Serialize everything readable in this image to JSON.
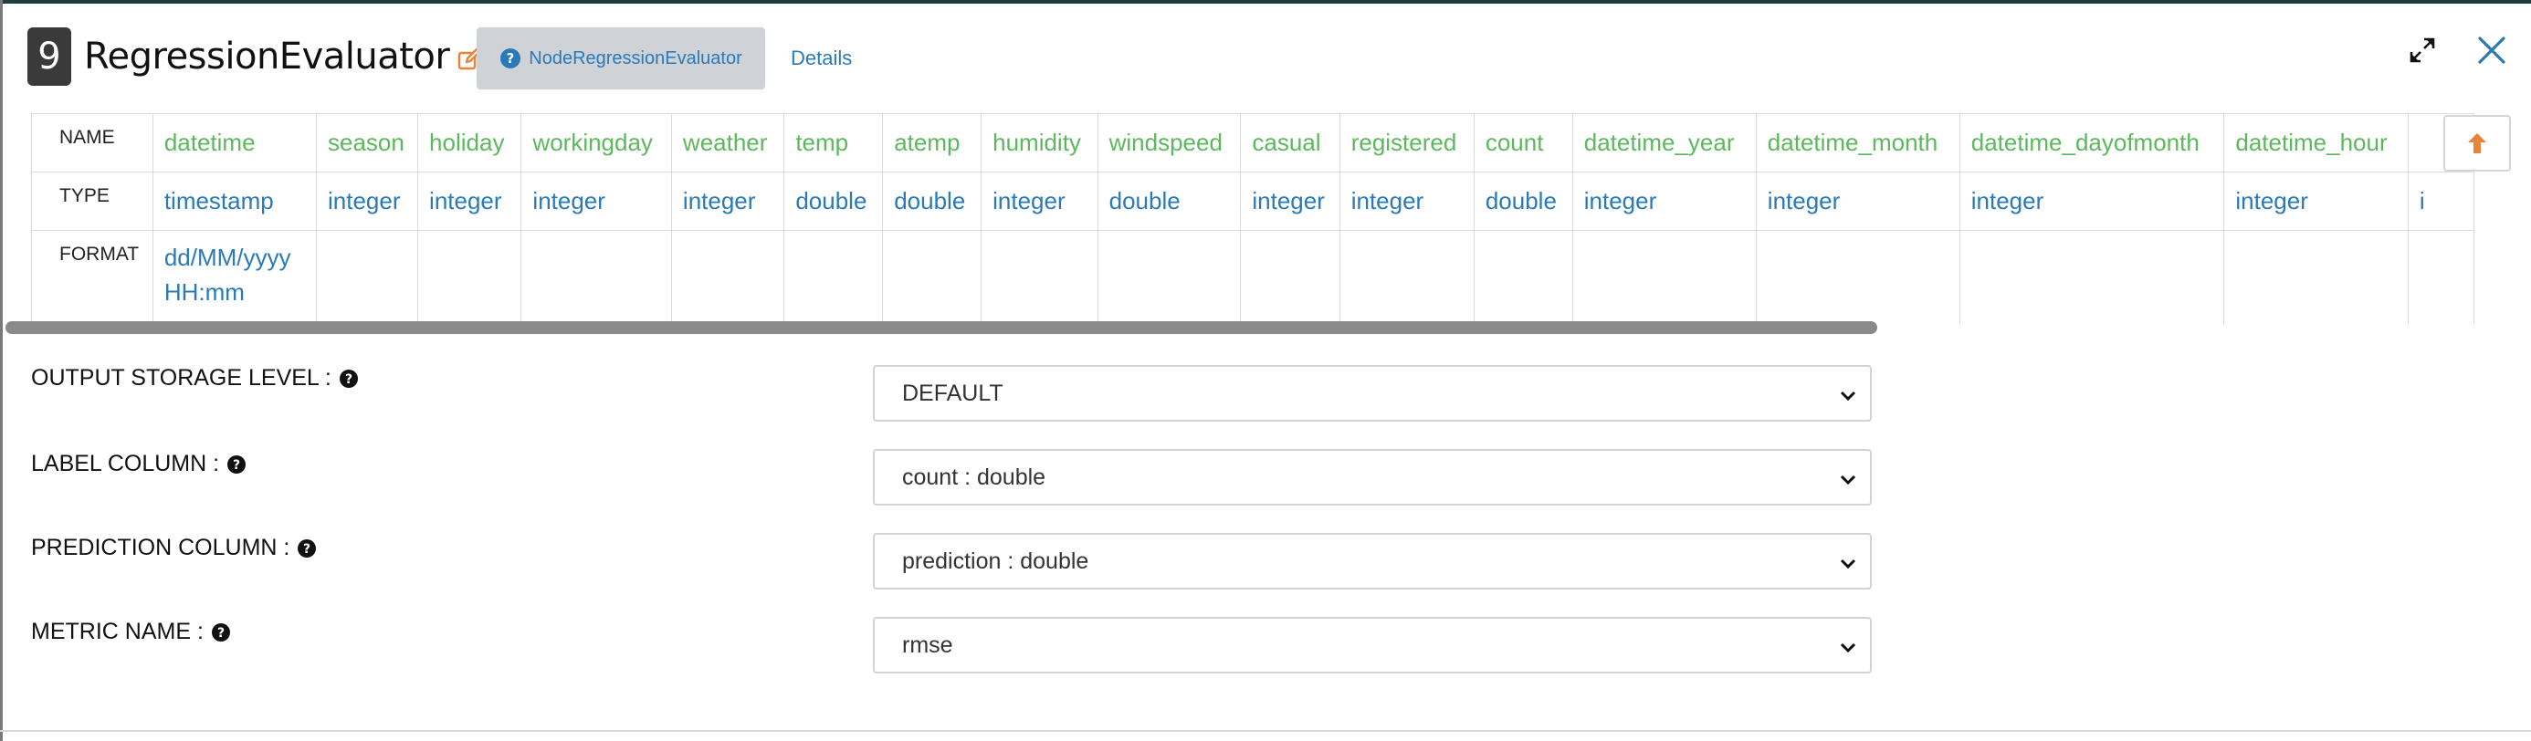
{
  "header": {
    "node_number": "9",
    "title": "RegressionEvaluator",
    "tabs": [
      {
        "label": "NodeRegressionEvaluator",
        "icon": "question-circle-icon"
      },
      {
        "label": "Details"
      }
    ]
  },
  "schema": {
    "row_labels": [
      "NAME",
      "TYPE",
      "FORMAT"
    ],
    "columns": [
      {
        "name": "datetime",
        "type": "timestamp",
        "format": "dd/MM/yyyy HH:mm"
      },
      {
        "name": "season",
        "type": "integer",
        "format": ""
      },
      {
        "name": "holiday",
        "type": "integer",
        "format": ""
      },
      {
        "name": "workingday",
        "type": "integer",
        "format": ""
      },
      {
        "name": "weather",
        "type": "integer",
        "format": ""
      },
      {
        "name": "temp",
        "type": "double",
        "format": ""
      },
      {
        "name": "atemp",
        "type": "double",
        "format": ""
      },
      {
        "name": "humidity",
        "type": "integer",
        "format": ""
      },
      {
        "name": "windspeed",
        "type": "double",
        "format": ""
      },
      {
        "name": "casual",
        "type": "integer",
        "format": ""
      },
      {
        "name": "registered",
        "type": "integer",
        "format": ""
      },
      {
        "name": "count",
        "type": "double",
        "format": ""
      },
      {
        "name": "datetime_year",
        "type": "integer",
        "format": ""
      },
      {
        "name": "datetime_month",
        "type": "integer",
        "format": ""
      },
      {
        "name": "datetime_dayofmonth",
        "type": "integer",
        "format": ""
      },
      {
        "name": "datetime_hour",
        "type": "integer",
        "format": ""
      },
      {
        "name": "",
        "type": "i",
        "format": ""
      }
    ]
  },
  "form": {
    "output_storage_level": {
      "label": "OUTPUT STORAGE LEVEL :",
      "value": "DEFAULT"
    },
    "label_column": {
      "label": "LABEL COLUMN :",
      "value": "count : double"
    },
    "prediction_column": {
      "label": "PREDICTION COLUMN :",
      "value": "prediction : double"
    },
    "metric_name": {
      "label": "METRIC NAME :",
      "value": "rmse"
    }
  },
  "colors": {
    "name_green": "#5cb85c",
    "type_blue": "#2a7ab8",
    "link_blue": "#2a7ab8",
    "edit_orange": "#e8833a",
    "badge_dark": "#3a3a3a",
    "tab_bg": "#cfd2d6"
  }
}
